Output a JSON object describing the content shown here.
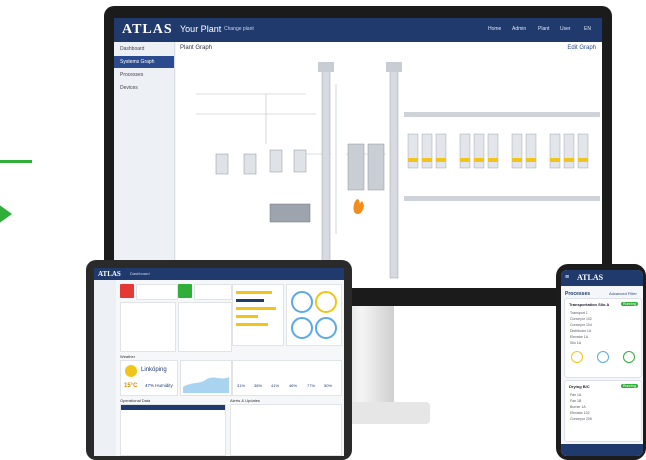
{
  "colors": {
    "brand": "#203a6e",
    "accent": "#2fae3a",
    "warning": "#f0c419",
    "danger": "#e53935"
  },
  "desktop": {
    "logo": "ATLAS",
    "app_title": "Your Plant",
    "app_subtitle": "Change plant",
    "nav": [
      "Home",
      "Admin",
      "Plant",
      "User",
      "EN"
    ],
    "sidebar": [
      "Dashboard",
      "Systems Graph",
      "Processes",
      "Devices"
    ],
    "canvas_title": "Plant Graph",
    "edit_label": "Edit Graph"
  },
  "tablet": {
    "logo": "ATLAS",
    "app_title": "Dashboard",
    "weather_city": "Linköping",
    "weather_temp": "15°C",
    "weather_humidity": "47% Humidity",
    "section_weather": "Weather",
    "section_ops": "Operational Data",
    "section_alerts": "Alerts & Updates",
    "gauges": [
      "31%",
      "38%",
      "41%",
      "46%",
      "77%",
      "50%"
    ]
  },
  "phone": {
    "logo": "ATLAS",
    "processes_title": "Processes",
    "filter_label": "Advanced Filter",
    "card1_title": "Transportation Silo A",
    "card1_badge": "Running",
    "card1_items": [
      "Transport 1",
      "Conveyor 102",
      "Conveyor 104",
      "Distributor 1A",
      "Elevator 1A",
      "Silo 1A"
    ],
    "card2_title": "Drying B/C",
    "card2_badge": "Running",
    "card2_items": [
      "Fan 1A",
      "Fan 1B",
      "Burner 1A",
      "Elevator 102",
      "Conveyor 205"
    ]
  }
}
